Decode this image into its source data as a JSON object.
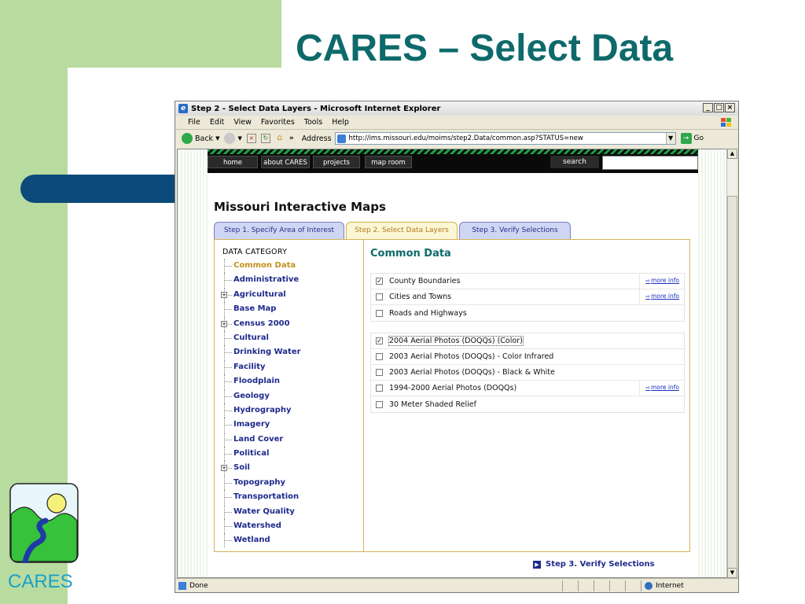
{
  "slide": {
    "title": "CARES – Select Data",
    "logo_caption": "CARES",
    "colors": {
      "title": "#0e6a6a",
      "green_band": "#b8dca0",
      "blue_bar": "#0b4a7a",
      "caption": "#1aa0c8"
    }
  },
  "browser": {
    "title": "Step 2 - Select Data Layers - Microsoft Internet Explorer",
    "window_buttons": [
      "_",
      "□",
      "×"
    ],
    "menu": [
      "File",
      "Edit",
      "View",
      "Favorites",
      "Tools",
      "Help"
    ],
    "toolbar": {
      "back_label": "Back",
      "address_label": "Address",
      "address_value": "http://ims.missouri.edu/moims/step2.Data/common.asp?STATUS=new",
      "go_label": "Go"
    },
    "status": {
      "text": "Done",
      "zone": "Internet"
    }
  },
  "site": {
    "nav": [
      "home",
      "about CARES",
      "projects",
      "map room"
    ],
    "search_label": "search",
    "heading": "Missouri Interactive Maps",
    "tabs": [
      {
        "label": "Step 1. Specify Area of Interest",
        "active": false
      },
      {
        "label": "Step 2. Select Data Layers",
        "active": true
      },
      {
        "label": "Step 3. Verify Selections",
        "active": false
      }
    ],
    "category_heading": "DATA CATEGORY",
    "categories": [
      {
        "label": "Common Data",
        "current": true,
        "expandable": false
      },
      {
        "label": "Administrative",
        "current": false,
        "expandable": false
      },
      {
        "label": "Agricultural",
        "current": false,
        "expandable": true
      },
      {
        "label": "Base Map",
        "current": false,
        "expandable": false
      },
      {
        "label": "Census 2000",
        "current": false,
        "expandable": true
      },
      {
        "label": "Cultural",
        "current": false,
        "expandable": false
      },
      {
        "label": "Drinking Water",
        "current": false,
        "expandable": false
      },
      {
        "label": "Facility",
        "current": false,
        "expandable": false
      },
      {
        "label": "Floodplain",
        "current": false,
        "expandable": false
      },
      {
        "label": "Geology",
        "current": false,
        "expandable": false
      },
      {
        "label": "Hydrography",
        "current": false,
        "expandable": false
      },
      {
        "label": "Imagery",
        "current": false,
        "expandable": false
      },
      {
        "label": "Land Cover",
        "current": false,
        "expandable": false
      },
      {
        "label": "Political",
        "current": false,
        "expandable": false
      },
      {
        "label": "Soil",
        "current": false,
        "expandable": true
      },
      {
        "label": "Topography",
        "current": false,
        "expandable": false
      },
      {
        "label": "Transportation",
        "current": false,
        "expandable": false
      },
      {
        "label": "Water Quality",
        "current": false,
        "expandable": false
      },
      {
        "label": "Watershed",
        "current": false,
        "expandable": false
      },
      {
        "label": "Wetland",
        "current": false,
        "expandable": false
      }
    ],
    "data_title": "Common Data",
    "more_info_label": "more info",
    "layer_groups": [
      [
        {
          "label": "County Boundaries",
          "checked": true,
          "more_info": true
        },
        {
          "label": "Cities and Towns",
          "checked": false,
          "more_info": true
        },
        {
          "label": "Roads and Highways",
          "checked": false,
          "more_info": false
        }
      ],
      [
        {
          "label": "2004 Aerial Photos (DOQQs) (Color)",
          "checked": true,
          "more_info": false,
          "focused": true
        },
        {
          "label": "2003 Aerial Photos (DOQQs) - Color Infrared",
          "checked": false,
          "more_info": false
        },
        {
          "label": "2003 Aerial Photos (DOQQs) - Black & White",
          "checked": false,
          "more_info": false
        },
        {
          "label": "1994-2000 Aerial Photos (DOQQs)",
          "checked": false,
          "more_info": true
        },
        {
          "label": "30 Meter Shaded Relief",
          "checked": false,
          "more_info": false
        }
      ]
    ],
    "next_link": "Step 3. Verify Selections"
  }
}
